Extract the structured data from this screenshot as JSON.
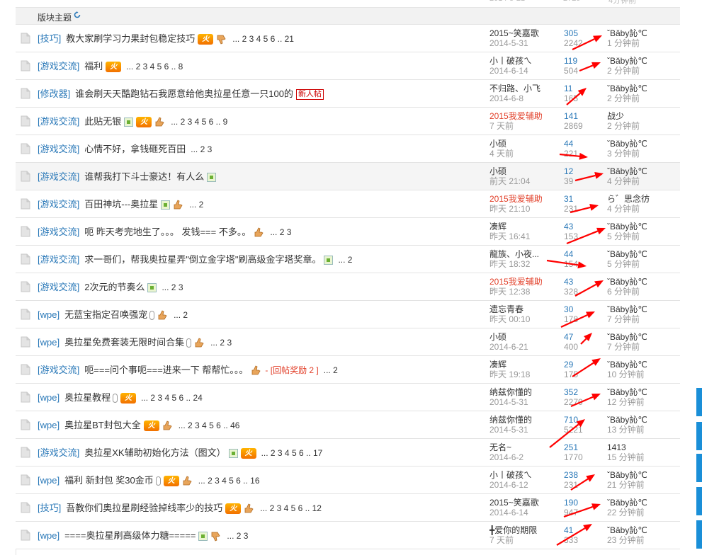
{
  "header": {
    "label": "版块主题",
    "refresh_icon": "refresh-icon"
  },
  "top_ghost": {
    "date": "2014-5-21",
    "views": "2729",
    "last": "4分钟前"
  },
  "colors": {
    "link": "#2b79b8",
    "red": "#e2412b",
    "gray": "#999999",
    "side_tab": "#1a8fd8",
    "arrow": "#ff0000"
  },
  "threads": [
    {
      "cat": "[技巧]",
      "title": "教大家刷学习力果封包稳定技巧",
      "icons": [
        "fire",
        "thumb-down"
      ],
      "pages": "... 2 3 4 5 6 .. 21",
      "reward": "",
      "new_tag": "",
      "author": "2015~笑嘉歌",
      "author_red": false,
      "date": "2014-5-31",
      "replies": "305",
      "views": "2242",
      "last_user": "ˇBǎby訫℃",
      "last_time": "1 分钟前"
    },
    {
      "cat": "[游戏交流]",
      "title": "福利",
      "icons": [
        "fire"
      ],
      "pages": "... 2 3 4 5 6 .. 8",
      "reward": "",
      "new_tag": "",
      "author": "小丨破孩ㄟ",
      "author_red": false,
      "date": "2014-6-14",
      "replies": "119",
      "views": "504",
      "last_user": "ˇBǎby訫℃",
      "last_time": "2 分钟前"
    },
    {
      "cat": "[修改器]",
      "title": "谁会刷天天酷跑钻石我愿意给他奥拉星任意一只100的",
      "icons": [],
      "pages": "",
      "reward": "",
      "new_tag": "新人帖",
      "author": "不归路、小飞",
      "author_red": false,
      "date": "2014-6-8",
      "replies": "11",
      "views": "165",
      "last_user": "ˇBǎby訫℃",
      "last_time": "2 分钟前"
    },
    {
      "cat": "[游戏交流]",
      "title": "此贴无银",
      "icons": [
        "img",
        "fire",
        "thumb"
      ],
      "pages": "... 2 3 4 5 6 .. 9",
      "reward": "",
      "new_tag": "",
      "author": "2015我爱辅助",
      "author_red": true,
      "date": "7 天前",
      "replies": "141",
      "views": "2869",
      "last_user": "战少",
      "last_time": "2 分钟前"
    },
    {
      "cat": "[游戏交流]",
      "title": "心情不好，拿钱砸死百田",
      "icons": [],
      "pages": "... 2 3",
      "reward": "",
      "new_tag": "",
      "author": "小硕",
      "author_red": false,
      "date": "4 天前",
      "replies": "44",
      "views": "221",
      "last_user": "ˇBǎby訫℃",
      "last_time": "3 分钟前"
    },
    {
      "cat": "[游戏交流]",
      "title": "谁帮我打下斗士豪达！有人么",
      "icons": [
        "img"
      ],
      "pages": "",
      "reward": "",
      "new_tag": "",
      "author": "小硕",
      "author_red": false,
      "date": "前天 21:04",
      "replies": "12",
      "views": "39",
      "last_user": "ˇBǎby訫℃",
      "last_time": "4 分钟前"
    },
    {
      "cat": "[游戏交流]",
      "title": "百田神坑---奥拉星",
      "icons": [
        "img",
        "thumb"
      ],
      "pages": "... 2",
      "reward": "",
      "new_tag": "",
      "author": "2015我爱辅助",
      "author_red": true,
      "date": "昨天 21:10",
      "replies": "31",
      "views": "231",
      "last_user": "ら゛思念彷",
      "last_time": "4 分钟前"
    },
    {
      "cat": "[游戏交流]",
      "title": "呃 昨天考完地生了。。。 发钱=== 不多。。",
      "icons": [
        "thumb"
      ],
      "pages": "... 2 3",
      "reward": "",
      "new_tag": "",
      "author": "凑辉",
      "author_red": false,
      "date": "昨天 16:41",
      "replies": "43",
      "views": "153",
      "last_user": "ˇBǎby訫℃",
      "last_time": "5 分钟前"
    },
    {
      "cat": "[游戏交流]",
      "title": "求一哥们，帮我奥拉星弄\"倒立金字塔\"刷高级金字塔奖章。",
      "icons": [
        "img"
      ],
      "pages": "... 2",
      "reward": "",
      "new_tag": "",
      "author": "龍族、小夜...",
      "author_red": false,
      "date": "昨天 18:32",
      "replies": "44",
      "views": "154",
      "last_user": "ˇBǎby訫℃",
      "last_time": "5 分钟前"
    },
    {
      "cat": "[游戏交流]",
      "title": "2次元的节奏么",
      "icons": [
        "img"
      ],
      "pages": "... 2 3",
      "reward": "",
      "new_tag": "",
      "author": "2015我爱辅助",
      "author_red": true,
      "date": "昨天 12:38",
      "replies": "43",
      "views": "328",
      "last_user": "ˇBǎby訫℃",
      "last_time": "6 分钟前"
    },
    {
      "cat": "[wpe]",
      "title": "无蓝宝指定召唤强宠",
      "icons": [
        "clip",
        "thumb"
      ],
      "pages": "... 2",
      "reward": "",
      "new_tag": "",
      "author": "遗忘青春",
      "author_red": false,
      "date": "昨天 00:10",
      "replies": "30",
      "views": "178",
      "last_user": "ˇBǎby訫℃",
      "last_time": "7 分钟前"
    },
    {
      "cat": "[wpe]",
      "title": "奥拉星免费套装无限时间合集",
      "icons": [
        "clip",
        "thumb"
      ],
      "pages": "... 2 3",
      "reward": "",
      "new_tag": "",
      "author": "小硕",
      "author_red": false,
      "date": "2014-6-21",
      "replies": "47",
      "views": "400",
      "last_user": "ˇBǎby訫℃",
      "last_time": "7 分钟前"
    },
    {
      "cat": "[游戏交流]",
      "title": "呃===问个事呃===进来一下 帮帮忙。。。",
      "icons": [
        "thumb"
      ],
      "pages": "... 2",
      "reward": "- [回帖奖励 2 ]",
      "new_tag": "",
      "author": "凑辉",
      "author_red": false,
      "date": "昨天 19:18",
      "replies": "29",
      "views": "175",
      "last_user": "ˇBǎby訫℃",
      "last_time": "10 分钟前"
    },
    {
      "cat": "[wpe]",
      "title": "奥拉星教程",
      "icons": [
        "clip",
        "fire"
      ],
      "pages": "... 2 3 4 5 6 .. 24",
      "reward": "",
      "new_tag": "",
      "author": "纳兹你懂的",
      "author_red": false,
      "date": "2014-5-31",
      "replies": "352",
      "views": "2270",
      "last_user": "ˇBǎby訫℃",
      "last_time": "12 分钟前"
    },
    {
      "cat": "[wpe]",
      "title": "奥拉星BT封包大全",
      "icons": [
        "fire",
        "thumb"
      ],
      "pages": "... 2 3 4 5 6 .. 46",
      "reward": "",
      "new_tag": "",
      "author": "纳兹你懂的",
      "author_red": false,
      "date": "2014-5-31",
      "replies": "710",
      "views": "5221",
      "last_user": "ˇBǎby訫℃",
      "last_time": "13 分钟前"
    },
    {
      "cat": "[游戏交流]",
      "title": "奥拉星XK辅助初始化方法（图文）",
      "icons": [
        "img",
        "fire"
      ],
      "pages": "... 2 3 4 5 6 .. 17",
      "reward": "",
      "new_tag": "",
      "author": "无名~",
      "author_red": false,
      "date": "2014-6-2",
      "replies": "251",
      "views": "1770",
      "last_user": "1413",
      "last_time": "15 分钟前"
    },
    {
      "cat": "[wpe]",
      "title": "福利 新封包 奖30金币",
      "icons": [
        "clip",
        "fire",
        "thumb"
      ],
      "pages": "... 2 3 4 5 6 .. 16",
      "reward": "",
      "new_tag": "",
      "author": "小丨破孩ㄟ",
      "author_red": false,
      "date": "2014-6-12",
      "replies": "238",
      "views": "231",
      "last_user": "ˇBǎby訫℃",
      "last_time": "21 分钟前"
    },
    {
      "cat": "[技巧]",
      "title": "吾教你们奥拉星刷经验掉线率少的技巧",
      "icons": [
        "fire",
        "thumb"
      ],
      "pages": "... 2 3 4 5 6 .. 12",
      "reward": "",
      "new_tag": "",
      "author": "2015~笑嘉歌",
      "author_red": false,
      "date": "2014-6-14",
      "replies": "190",
      "views": "947",
      "last_user": "ˇBǎby訫℃",
      "last_time": "22 分钟前"
    },
    {
      "cat": "[wpe]",
      "title": "====奥拉星刷高级体力糖=====",
      "icons": [
        "img",
        "thumb-down"
      ],
      "pages": "... 2 3",
      "reward": "",
      "new_tag": "",
      "author": "╋爱你的期限",
      "author_red": false,
      "date": "7 天前",
      "replies": "41",
      "views": "333",
      "last_user": "ˇBǎby訫℃",
      "last_time": "23 分钟前"
    }
  ]
}
